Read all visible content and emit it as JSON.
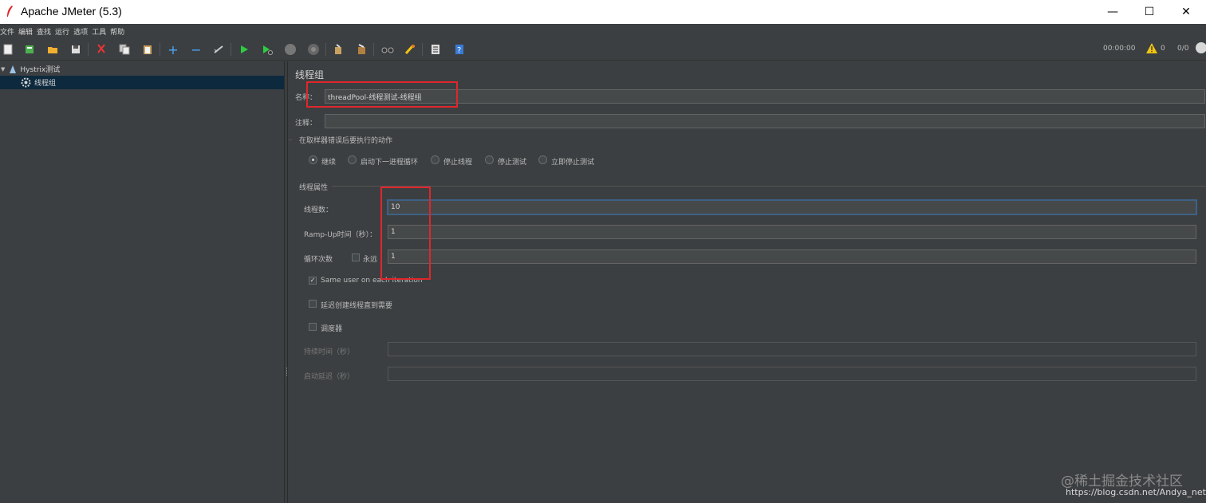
{
  "window": {
    "title": "Apache JMeter (5.3)",
    "minimize": "—",
    "maximize": "☐",
    "close": "✕"
  },
  "menu": [
    "文件",
    "编辑",
    "查找",
    "运行",
    "选项",
    "工具",
    "帮助"
  ],
  "toolbar": {
    "icons": [
      "new-icon",
      "templates-icon",
      "open-icon",
      "save-icon",
      "cut-icon",
      "copy-icon",
      "paste-icon",
      "expand-icon",
      "collapse-icon",
      "toggle-icon",
      "start-icon",
      "start-no-pause-icon",
      "stop-icon",
      "shutdown-icon",
      "clear-icon",
      "clear-all-icon",
      "search-icon",
      "reset-search-icon",
      "function-helper-icon",
      "help-icon"
    ],
    "elapsed": "00:00:00",
    "warnings": "0",
    "threads": "0/0"
  },
  "tree": {
    "root": "Hystrix测试",
    "child": "线程组"
  },
  "panel": {
    "title": "线程组",
    "name_label": "名称：",
    "name_value": "threadPool-线程测试-线程组",
    "comment_label": "注释：",
    "comment_value": "",
    "error_action_title": "在取样器错误后要执行的动作",
    "error_actions": [
      "继续",
      "启动下一进程循环",
      "停止线程",
      "停止测试",
      "立即停止测试"
    ],
    "thread_props_title": "线程属性",
    "threads_label": "线程数：",
    "threads_value": "10",
    "rampup_label": "Ramp-Up时间（秒）：",
    "rampup_value": "1",
    "loop_label": "循环次数",
    "forever_label": "永远",
    "loop_value": "1",
    "same_user_label": "Same user on each iteration",
    "delay_label": "延迟创建线程直到需要",
    "scheduler_label": "调度器",
    "duration_label": "持续时间（秒）",
    "duration_value": "",
    "startup_label": "启动延迟（秒）",
    "startup_value": ""
  },
  "watermark": {
    "line1": "@稀土掘金技术社区",
    "line2": "https://blog.csdn.net/Andya_net"
  }
}
